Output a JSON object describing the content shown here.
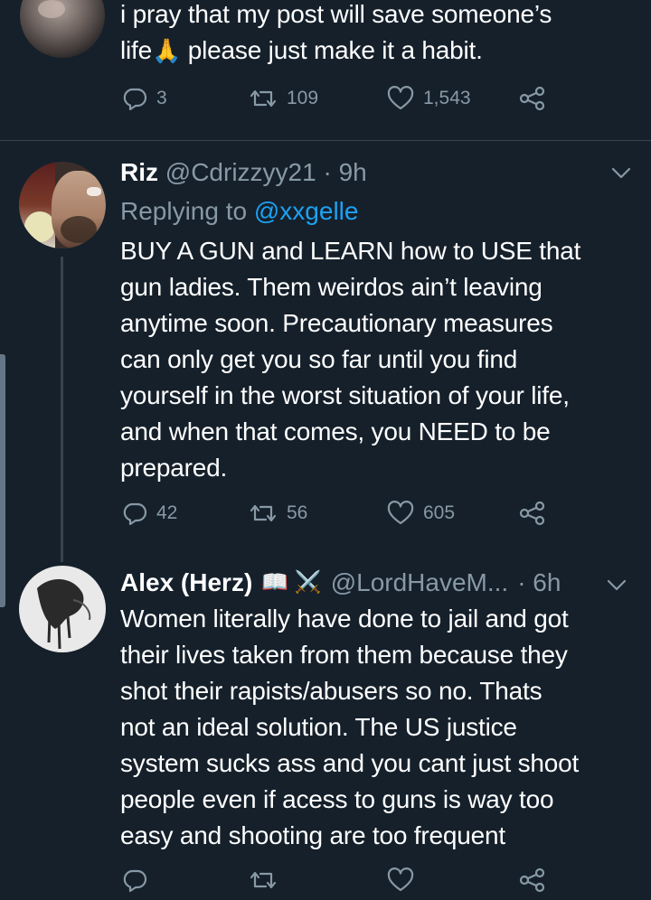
{
  "tweets": [
    {
      "text_lines": [
        "i pray that my post will save someone’s",
        "please just make it a habit."
      ],
      "inline_emoji": "🙏",
      "life_word": "life",
      "replies": "3",
      "retweets": "109",
      "likes": "1,543"
    },
    {
      "name": "Riz",
      "handle": "@Cdrizzyy21",
      "time": "· 9h",
      "replying_label": "Replying to",
      "replying_to": "@xxgelle",
      "text_lines": [
        "BUY A GUN and LEARN how to USE that",
        "gun ladies. Them weirdos ain’t leaving",
        "anytime soon. Precautionary measures",
        "can only get you so far until you find",
        "yourself in the worst situation of your life,",
        "and when that comes, you NEED to be",
        "prepared."
      ],
      "replies": "42",
      "retweets": "56",
      "likes": "605"
    },
    {
      "name": "Alex (Herz)",
      "name_emojis": "📖 ⚔️",
      "handle": "@LordHaveM...",
      "time": "· 6h",
      "text_lines": [
        "Women literally have done to jail and got",
        "their lives taken from them because they",
        "shot their rapists/abusers so no. Thats",
        "not an ideal solution. The US justice",
        "system sucks ass and you cant just shoot",
        "people even if acess to guns is way too",
        "easy and shooting are too frequent"
      ]
    }
  ],
  "colors": {
    "background": "#15202b",
    "text": "#ffffff",
    "secondary": "#8899a6",
    "link": "#1da1f2",
    "divider": "#38444d"
  }
}
